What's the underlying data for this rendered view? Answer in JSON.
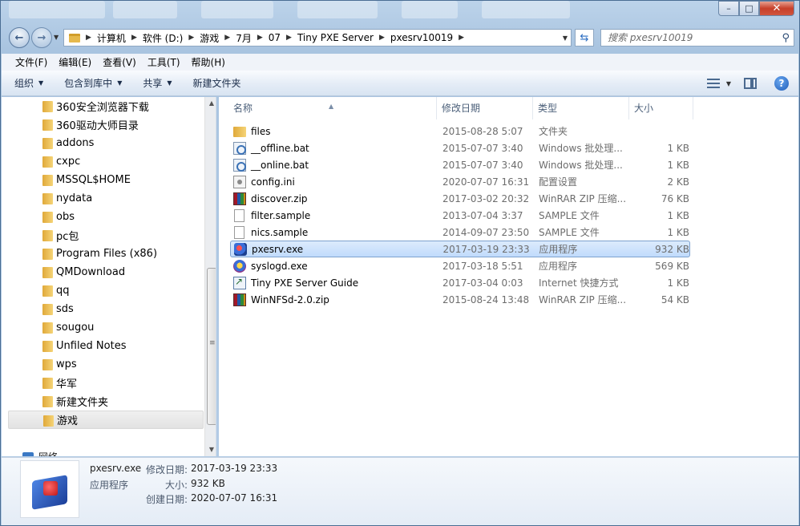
{
  "window": {
    "controls": {
      "minimize": "–",
      "maximize": "□",
      "close": "✕"
    }
  },
  "nav": {
    "back_icon": "back-arrow-icon",
    "forward_icon": "forward-arrow-icon",
    "breadcrumbs": [
      "计算机",
      "软件 (D:)",
      "游戏",
      "7月",
      "07",
      "Tiny PXE Server",
      "pxesrv10019"
    ],
    "search_placeholder": "搜索 pxesrv10019"
  },
  "menubar": {
    "items": [
      "文件(F)",
      "编辑(E)",
      "查看(V)",
      "工具(T)",
      "帮助(H)"
    ]
  },
  "toolbar": {
    "organize": "组织",
    "include_library": "包含到库中",
    "share": "共享",
    "new_folder": "新建文件夹",
    "help": "?"
  },
  "tree": {
    "items": [
      "360安全浏览器下载",
      "360驱动大师目录",
      "addons",
      "cxpc",
      "MSSQL$HOME",
      "nydata",
      "obs",
      "pc包",
      "Program Files (x86)",
      "QMDownload",
      "qq",
      "sds",
      "sougou",
      "Unfiled Notes",
      "wps",
      "华军",
      "新建文件夹",
      "游戏"
    ],
    "selected": "游戏",
    "network": "网络"
  },
  "columns": {
    "name": "名称",
    "date": "修改日期",
    "type": "类型",
    "size": "大小"
  },
  "files": [
    {
      "name": "files",
      "date": "2015-08-28 5:07",
      "type": "文件夹",
      "size": "",
      "icon": "folder"
    },
    {
      "name": "__offline.bat",
      "date": "2015-07-07 3:40",
      "type": "Windows 批处理...",
      "size": "1 KB",
      "icon": "bat"
    },
    {
      "name": "__online.bat",
      "date": "2015-07-07 3:40",
      "type": "Windows 批处理...",
      "size": "1 KB",
      "icon": "bat"
    },
    {
      "name": "config.ini",
      "date": "2020-07-07 16:31",
      "type": "配置设置",
      "size": "2 KB",
      "icon": "ini"
    },
    {
      "name": "discover.zip",
      "date": "2017-03-02 20:32",
      "type": "WinRAR ZIP 压缩...",
      "size": "76 KB",
      "icon": "zip"
    },
    {
      "name": "filter.sample",
      "date": "2013-07-04 3:37",
      "type": "SAMPLE 文件",
      "size": "1 KB",
      "icon": "file"
    },
    {
      "name": "nics.sample",
      "date": "2014-09-07 23:50",
      "type": "SAMPLE 文件",
      "size": "1 KB",
      "icon": "file"
    },
    {
      "name": "pxesrv.exe",
      "date": "2017-03-19 23:33",
      "type": "应用程序",
      "size": "932 KB",
      "icon": "exe"
    },
    {
      "name": "syslogd.exe",
      "date": "2017-03-18 5:51",
      "type": "应用程序",
      "size": "569 KB",
      "icon": "syslog"
    },
    {
      "name": "Tiny PXE Server Guide",
      "date": "2017-03-04 0:03",
      "type": "Internet 快捷方式",
      "size": "1 KB",
      "icon": "link"
    },
    {
      "name": "WinNFSd-2.0.zip",
      "date": "2015-08-24 13:48",
      "type": "WinRAR ZIP 压缩...",
      "size": "54 KB",
      "icon": "zip"
    }
  ],
  "selected_file": "pxesrv.exe",
  "details": {
    "filename": "pxesrv.exe",
    "filetype": "应用程序",
    "modified_label": "修改日期:",
    "modified_value": "2017-03-19 23:33",
    "size_label": "大小:",
    "size_value": "932 KB",
    "created_label": "创建日期:",
    "created_value": "2020-07-07 16:31"
  }
}
